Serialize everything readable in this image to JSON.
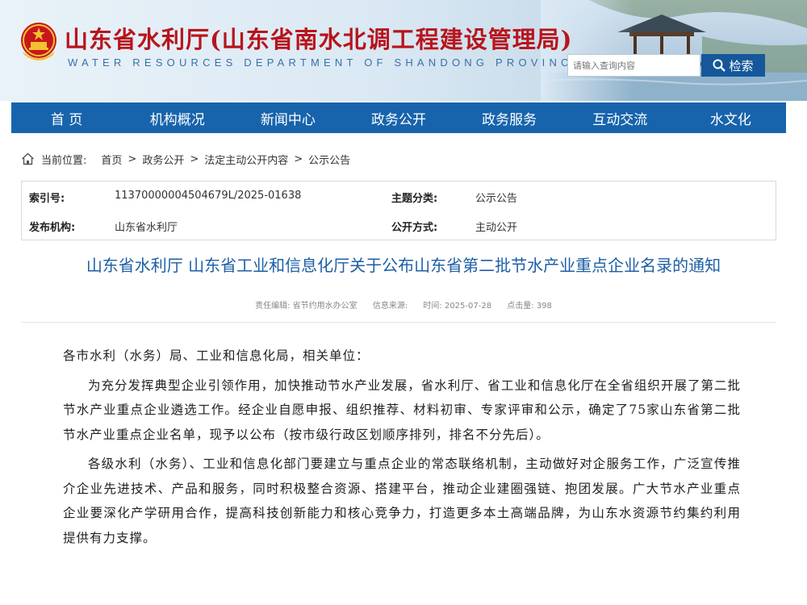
{
  "header": {
    "title_cn": "山东省水利厅(山东省南水北调工程建设管理局)",
    "title_en": "WATER RESOURCES DEPARTMENT OF SHANDONG PROVINCE",
    "search_placeholder": "请输入查询内容",
    "search_button": "检索"
  },
  "nav": {
    "items": [
      "首 页",
      "机构概况",
      "新闻中心",
      "政务公开",
      "政务服务",
      "互动交流",
      "水文化"
    ]
  },
  "breadcrumb": {
    "label": "当前位置:",
    "items": [
      "首页",
      "政务公开",
      "法定主动公开内容",
      "公示公告"
    ],
    "separator": ">"
  },
  "info": {
    "index_key": "索引号:",
    "index_value": "11370000004504679L/2025-01638",
    "category_key": "主题分类:",
    "category_value": "公示公告",
    "publisher_key": "发布机构:",
    "publisher_value": "山东省水利厅",
    "method_key": "公开方式:",
    "method_value": "主动公开"
  },
  "article": {
    "title": "山东省水利厅 山东省工业和信息化厅关于公布山东省第二批节水产业重点企业名录的通知",
    "meta": {
      "editor": "责任编辑: 省节约用水办公室",
      "source": "信息来源:",
      "time": "时间: 2025-07-28",
      "views": "点击量: 398"
    },
    "paragraphs": [
      "各市水利（水务）局、工业和信息化局，相关单位：",
      "为充分发挥典型企业引领作用，加快推动节水产业发展，省水利厅、省工业和信息化厅在全省组织开展了第二批节水产业重点企业遴选工作。经企业自愿申报、组织推荐、材料初审、专家评审和公示，确定了75家山东省第二批节水产业重点企业名单，现予以公布（按市级行政区划顺序排列，排名不分先后）。",
      "各级水利（水务）、工业和信息化部门要建立与重点企业的常态联络机制，主动做好对企服务工作，广泛宣传推介企业先进技术、产品和服务，同时积极整合资源、搭建平台，推动企业建圈强链、抱团发展。广大节水产业重点企业要深化产学研用合作，提高科技创新能力和核心竞争力，打造更多本土高端品牌，为山东水资源节约集约利用提供有力支撑。"
    ]
  },
  "colors": {
    "nav_bg": "#1864ac",
    "title_red": "#b8141c",
    "article_title_blue": "#1d5fa5"
  }
}
